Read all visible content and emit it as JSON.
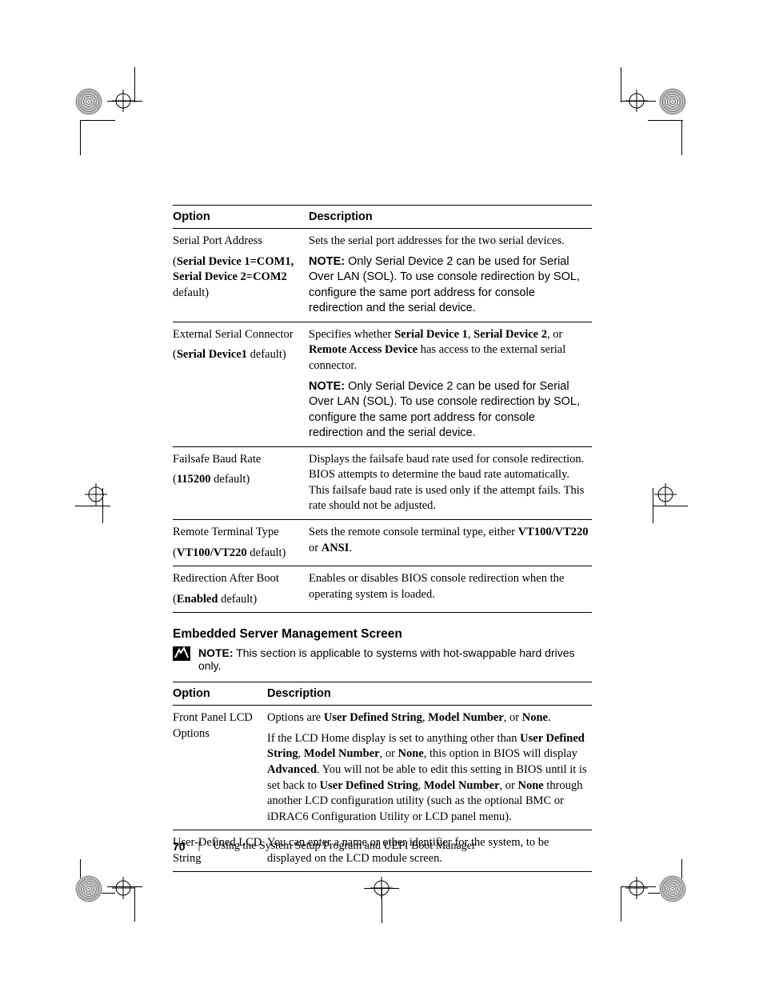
{
  "table1": {
    "headers": {
      "option": "Option",
      "description": "Description"
    },
    "rows": [
      {
        "option_para1": "Serial Port Address",
        "option_para2_pre": "(",
        "option_para2_b1": "Serial Device 1=COM1, Serial Device 2=COM2",
        "option_para2_post": " default)",
        "desc_para1": "Sets the serial port addresses for the two serial devices.",
        "desc_note_label": "NOTE:",
        "desc_note_body": " Only Serial Device 2 can be used for Serial Over LAN (SOL). To use console redirection by SOL, configure the same port address for console redirection and the serial device."
      },
      {
        "option_para1": "External Serial Connector",
        "option_para2_pre": "(",
        "option_para2_b1": "Serial Device1",
        "option_para2_post": " default)",
        "desc_p1_pre": "Specifies whether ",
        "desc_p1_b1": "Serial Device 1",
        "desc_p1_mid1": ", ",
        "desc_p1_b2": "Serial Device 2",
        "desc_p1_mid2": ", or ",
        "desc_p1_b3": "Remote Access Device",
        "desc_p1_post": " has access to the external serial connector.",
        "desc_note_label": "NOTE:",
        "desc_note_body": " Only Serial Device 2 can be used for Serial Over LAN (SOL). To use console redirection by SOL, configure the same port address for console redirection and the serial device."
      },
      {
        "option_para1": "Failsafe Baud Rate",
        "option_para2_pre": "(",
        "option_para2_b1": "115200",
        "option_para2_post": " default)",
        "desc_para1": "Displays the failsafe baud rate used for console redirection. BIOS attempts to determine the baud rate automatically. This failsafe baud rate is used only if the attempt fails. This rate should not be adjusted."
      },
      {
        "option_para1": "Remote Terminal Type",
        "option_para2_pre": "(",
        "option_para2_b1": "VT100/VT220",
        "option_para2_post": " default)",
        "desc_p1_pre": "Sets the remote console terminal type, either ",
        "desc_p1_b1": "VT100/VT220",
        "desc_p1_mid1": " or ",
        "desc_p1_b2": "ANSI",
        "desc_p1_post": "."
      },
      {
        "option_para1": "Redirection After Boot",
        "option_para2_pre": "(",
        "option_para2_b1": "Enabled",
        "option_para2_post": " default)",
        "desc_para1": "Enables or disables BIOS console redirection when the operating system is loaded."
      }
    ]
  },
  "section_heading": "Embedded Server Management Screen",
  "section_note": {
    "label": "NOTE:",
    "body": " This section is applicable to systems with hot-swappable hard drives only."
  },
  "table2": {
    "headers": {
      "option": "Option",
      "description": "Description"
    },
    "rows": [
      {
        "option": "Front Panel LCD Options",
        "p1_pre": "Options are ",
        "p1_b1": "User Defined String",
        "p1_mid1": ", ",
        "p1_b2": "Model Number",
        "p1_mid2": ", or ",
        "p1_b3": "None",
        "p1_post": ".",
        "p2_pre": "If the LCD Home display is set to anything other than ",
        "p2_b1": "User Defined String",
        "p2_mid1": ", ",
        "p2_b2": "Model Number",
        "p2_mid2": ", or ",
        "p2_b3": "None",
        "p2_mid3": ", this option in BIOS will display ",
        "p2_b4": "Advanced",
        "p2_mid4": ". You will not be able to edit this setting in BIOS until it is set back to ",
        "p2_b5": "User Defined String",
        "p2_mid5": ", ",
        "p2_b6": "Model Number",
        "p2_mid6": ", or ",
        "p2_b7": "None",
        "p2_post": " through another LCD configuration utility (such as the optional BMC or iDRAC6 Configuration Utility or LCD panel menu)."
      },
      {
        "option": "User-Defined LCD String",
        "desc": "You can enter a name or other identifier for the system, to be displayed on the LCD module screen."
      }
    ]
  },
  "footer": {
    "page_number": "70",
    "separator": "|",
    "chapter": "Using the System Setup Program and UEFI Boot Manager"
  }
}
